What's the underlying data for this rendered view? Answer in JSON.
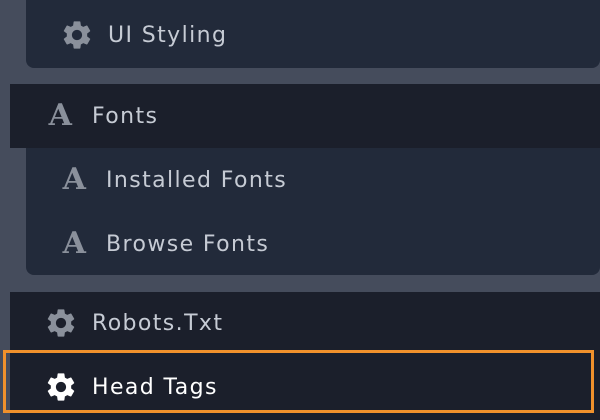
{
  "menu": {
    "ui_styling": {
      "label": "UI Styling",
      "icon": "gear-icon"
    },
    "fonts": {
      "label": "Fonts",
      "icon": "font-a-icon",
      "children": [
        {
          "label": "Installed Fonts",
          "icon": "font-a-icon"
        },
        {
          "label": "Browse Fonts",
          "icon": "font-a-icon"
        }
      ]
    },
    "robots": {
      "label": "Robots.Txt",
      "icon": "gear-icon"
    },
    "head_tags": {
      "label": "Head Tags",
      "icon": "gear-icon"
    }
  },
  "icon_glyphs": {
    "font": "A"
  },
  "colors": {
    "background": "#454c5c",
    "nav_bar": "#1b1f2b",
    "sub_panel": "#222a3a",
    "text": "#c6cbd4",
    "icon": "#8a909b",
    "active_text": "#ffffff",
    "highlight_border": "#f0912c"
  }
}
